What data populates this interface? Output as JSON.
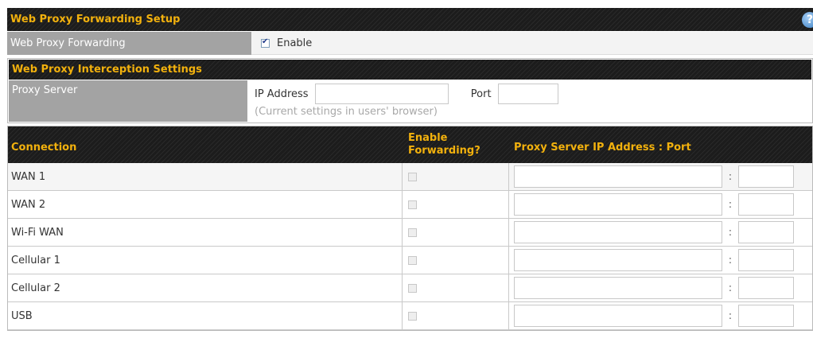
{
  "setup": {
    "title": "Web Proxy Forwarding Setup",
    "help_icon": "?",
    "forwarding_label": "Web Proxy Forwarding",
    "enable_label": "Enable",
    "enable_checked": true
  },
  "interception": {
    "title": "Web Proxy Interception Settings",
    "proxy_server_label": "Proxy Server",
    "ip_label": "IP Address",
    "ip_value": "",
    "port_label": "Port",
    "port_value": "",
    "hint": "(Current settings in users' browser)"
  },
  "table": {
    "headers": {
      "connection": "Connection",
      "enable_forwarding": "Enable Forwarding?",
      "proxy_ip_port": "Proxy Server IP Address : Port"
    },
    "separator": ":",
    "rows": [
      {
        "name": "WAN 1",
        "enabled": false,
        "ip": "",
        "port": ""
      },
      {
        "name": "WAN 2",
        "enabled": false,
        "ip": "",
        "port": ""
      },
      {
        "name": "Wi-Fi WAN",
        "enabled": false,
        "ip": "",
        "port": ""
      },
      {
        "name": "Cellular 1",
        "enabled": false,
        "ip": "",
        "port": ""
      },
      {
        "name": "Cellular 2",
        "enabled": false,
        "ip": "",
        "port": ""
      },
      {
        "name": "USB",
        "enabled": false,
        "ip": "",
        "port": ""
      }
    ]
  },
  "colors": {
    "header_bg": "#1c1c1c",
    "header_text": "#f2b10d",
    "label_bg": "#a3a3a3"
  }
}
